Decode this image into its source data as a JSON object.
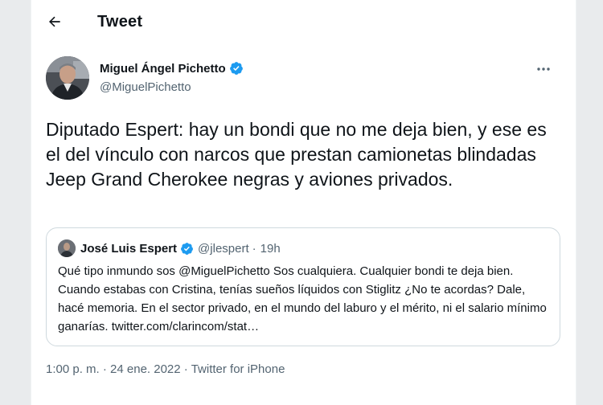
{
  "header": {
    "title": "Tweet"
  },
  "tweet": {
    "author": {
      "name": "Miguel Ángel Pichetto",
      "handle": "@MiguelPichetto",
      "verified": true
    },
    "text": "Diputado Espert: hay un bondi que no me deja bien, y ese es el del vínculo con narcos que prestan camionetas blindadas Jeep Grand Cherokee negras y aviones privados.",
    "timestamp": "1:00 p. m. · 24 ene. 2022",
    "separator": "·",
    "source": "Twitter for iPhone"
  },
  "quoted_tweet": {
    "author_name": "José Luis Espert",
    "handle": "@jlespert",
    "separator": "·",
    "time": "19h",
    "text": "Qué tipo inmundo sos @MiguelPichetto Sos cualquiera. Cualquier bondi te deja bien. Cuando estabas con Cristina, tenías sueños líquidos con Stiglitz ¿No te acordas? Dale, hacé memoria. En el sector privado, en el mundo del laburo y el mérito, ni el salario mínimo ganarías. twitter.com/clarincom/stat…"
  },
  "icons": {
    "back": "arrow-left-icon",
    "verified": "verified-badge-icon",
    "more": "more-horizontal-icon"
  },
  "colors": {
    "page_background": "#e9ebed",
    "card_background": "#ffffff",
    "text_primary": "#0f1419",
    "text_secondary": "#536471",
    "verified_blue": "#1d9bf0",
    "border": "#cfd9de"
  }
}
